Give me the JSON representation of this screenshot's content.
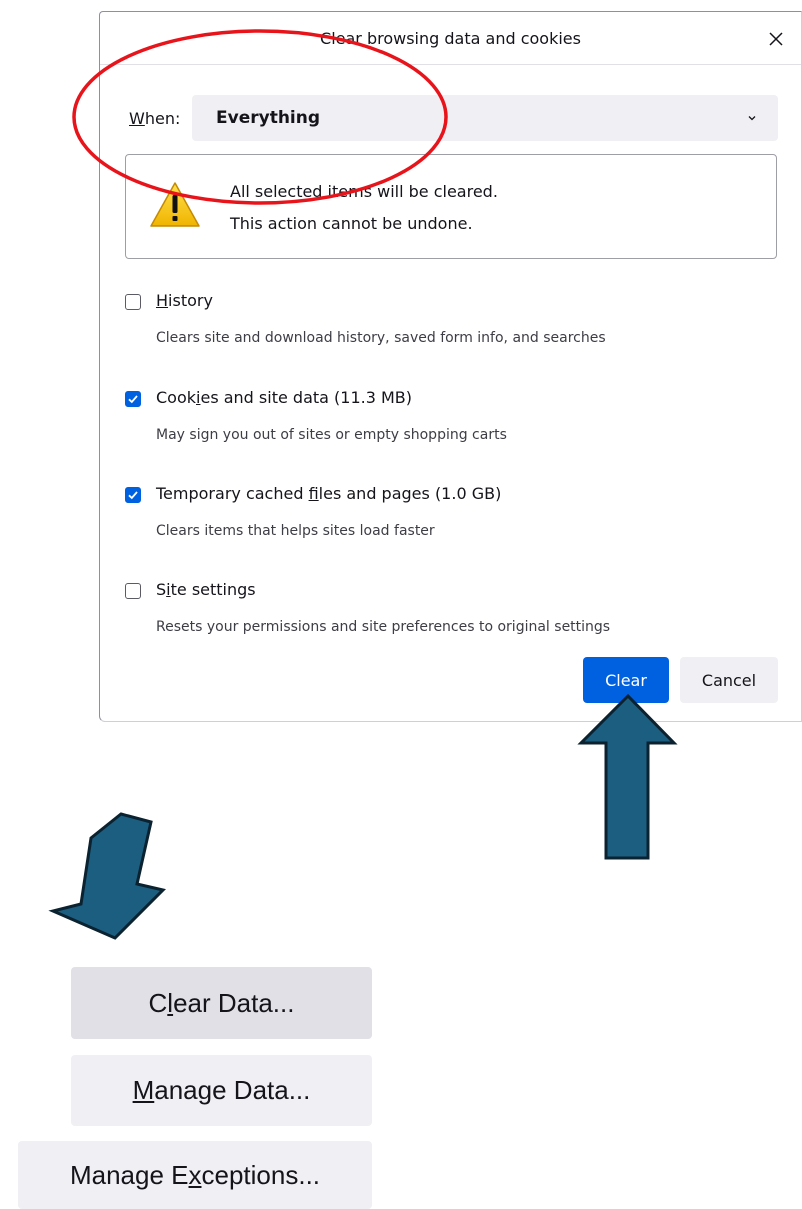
{
  "dialog": {
    "title": "Clear browsing data and cookies",
    "when_label_prefix": "W",
    "when_label_rest": "hen:",
    "when_value": "Everything",
    "warning_line1": "All selected items will be cleared.",
    "warning_line2": "This action cannot be undone.",
    "options": [
      {
        "label_pre": "",
        "label_u": "H",
        "label_post": "istory",
        "checked": false,
        "description": "Clears site and download history, saved form info, and searches"
      },
      {
        "label_pre": "Cook",
        "label_u": "i",
        "label_post": "es and site data (11.3 MB)",
        "checked": true,
        "description": "May sign you out of sites or empty shopping carts"
      },
      {
        "label_pre": "Temporary cached ",
        "label_u": "f",
        "label_post": "iles and pages (1.0 GB)",
        "checked": true,
        "description": "Clears items that helps sites load faster"
      },
      {
        "label_pre": "S",
        "label_u": "i",
        "label_post": "te settings",
        "checked": false,
        "description": "Resets your permissions and site preferences to original settings"
      }
    ],
    "clear_label": "Clear",
    "cancel_label": "Cancel"
  },
  "buttons": {
    "clear_data": {
      "pre": "C",
      "u": "l",
      "post": "ear Data..."
    },
    "manage_data": {
      "pre": "",
      "u": "M",
      "post": "anage Data..."
    },
    "manage_exceptions": {
      "pre": "Manage E",
      "u": "x",
      "post": "ceptions..."
    }
  },
  "colors": {
    "accent": "#0061e0",
    "annotation_red": "#e8141b",
    "arrow_fill": "#1b5e80",
    "arrow_stroke": "#0b2230"
  },
  "icons": [
    "close-icon",
    "chevron-down-icon",
    "warning-icon",
    "checkmark-icon",
    "arrow-up-icon",
    "arrow-down-left-icon"
  ]
}
